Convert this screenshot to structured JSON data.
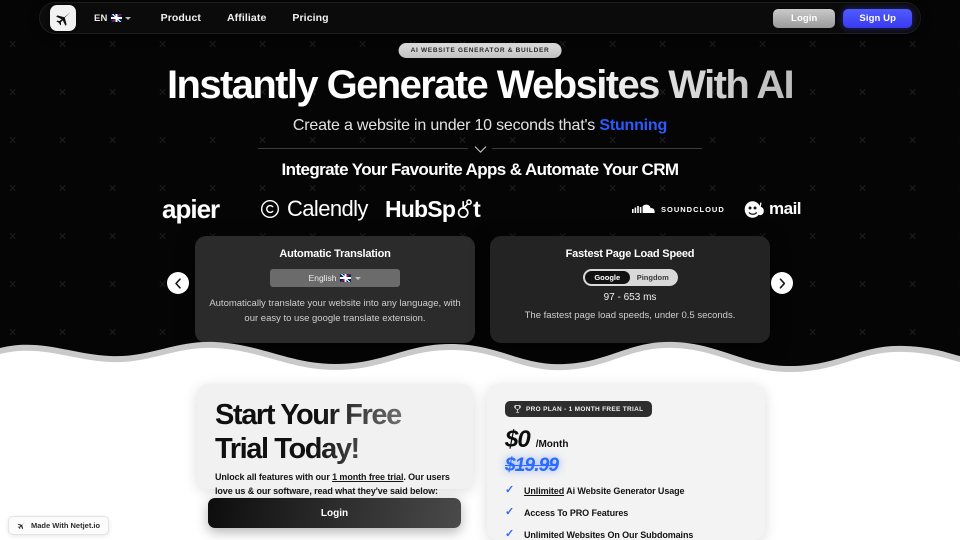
{
  "navbar": {
    "logo_icon": "jet-plane-icon",
    "language": {
      "code": "EN",
      "flag": "uk-flag-icon"
    },
    "links": [
      {
        "label": "Product"
      },
      {
        "label": "Affiliate"
      },
      {
        "label": "Pricing"
      }
    ],
    "login_label": "Login",
    "signup_label": "Sign Up"
  },
  "hero": {
    "badge": "AI WEBSITE GENERATOR & BUILDER",
    "title": "Instantly Generate Websites With AI",
    "subtitle_prefix": "Create a website in under 10 seconds that's",
    "subtitle_highlight": "Stunning",
    "integrate_title": "Integrate Your Favourite Apps & Automate Your CRM"
  },
  "logos": [
    {
      "name": "zapier-logo",
      "label": "apier"
    },
    {
      "name": "calendly-logo",
      "label": "Calendly"
    },
    {
      "name": "hubspot-logo",
      "label": "HubSp"
    },
    {
      "name": "hubspot-logo-tail",
      "label": "t"
    },
    {
      "name": "soundcloud-logo",
      "label": "SOUNDCLOUD"
    },
    {
      "name": "mailchimp-logo",
      "label": "mail"
    }
  ],
  "feature_cards": [
    {
      "title": "Automatic Translation",
      "select_value": "English",
      "select_flag": "uk-flag-icon",
      "description": "Automatically translate your website into any language, with our easy to use google translate extension."
    },
    {
      "title": "Fastest Page Load Speed",
      "toggle": {
        "options": [
          "Google",
          "Pingdom"
        ],
        "selected": "Google"
      },
      "metric": "97 - 653 ms",
      "description": "The fastest page load speeds, under 0.5 seconds."
    }
  ],
  "carousel": {
    "prev_icon": "chevron-left-icon",
    "next_icon": "chevron-right-icon"
  },
  "trial": {
    "heading_line1": "Start Your Free",
    "heading_line2": "Trial Today!",
    "body_before": "Unlock all features with our ",
    "body_link": "1 month free trial",
    "body_after": ". Our users love us & our software, read what they've said below:",
    "login_label": "Login"
  },
  "pricing": {
    "plan_badge": "PRO PLAN - 1 MONTH FREE TRIAL",
    "plan_badge_icon": "trophy-icon",
    "price_now": "$0",
    "price_period": "/Month",
    "price_old": "$19.99",
    "accent_color": "#2b6bff",
    "features": [
      {
        "emphasis": "Unlimited",
        "rest": " Ai Website Generator Usage"
      },
      {
        "emphasis": "",
        "rest": "Access To PRO Features"
      },
      {
        "emphasis": "",
        "rest": "Unlimited Websites On Our Subdomains"
      }
    ]
  },
  "made_badge": {
    "label": "Made With Netjet.io",
    "icon": "jet-plane-icon"
  },
  "colors": {
    "hero_bg": "#050505",
    "signup_blue": "#4f5bff",
    "accent_blue": "#2b6bff",
    "card_dark": "#2b2b2b",
    "card_light": "#f1f1f1"
  }
}
